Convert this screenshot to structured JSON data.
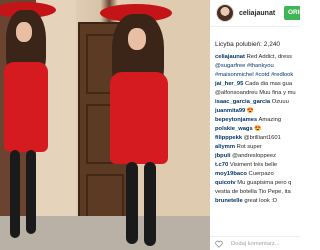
{
  "post": {
    "username": "celiajaunat",
    "follow_label": "ORIGIN",
    "likes_text": "Licyba polubień: 2,240",
    "caption_user": "celiajaunat",
    "caption_lines": [
      "Red Addict, dress",
      "@sugarfree #thankyou",
      "#maisonmichel #cotd #redlook"
    ],
    "comments": [
      {
        "user": "jai_her_95",
        "text": "Cada dia mas gua"
      },
      {
        "user": "",
        "text": "@alfonsoandreu Muu fina y mu"
      },
      {
        "user": "isaac_garcia_garcia",
        "text": "Ozuuu"
      },
      {
        "user": "juanmita99",
        "text": "😍"
      },
      {
        "user": "bepeytonjames",
        "text": "Amazing"
      },
      {
        "user": "polskie_wags",
        "text": "😍"
      },
      {
        "user": "filipppekk",
        "text": "@brilliant1601"
      },
      {
        "user": "aliymm",
        "text": "Rot super"
      },
      {
        "user": "jbpuli",
        "text": "@andresloppeez"
      },
      {
        "user": "t.c70",
        "text": "Visiment très belle"
      },
      {
        "user": "moy19baco",
        "text": "Cuerpazo"
      },
      {
        "user": "quicotv",
        "text": "Mu guapisima pero q"
      },
      {
        "user": "",
        "text": "vestia de botella Tio Pepe, ita"
      },
      {
        "user": "brunetelle",
        "text": "great look :D"
      }
    ],
    "add_comment_placeholder": "Dodaj komentarz..."
  },
  "colors": {
    "accent_green": "#3fb556",
    "link_blue": "#003569",
    "dress_red": "#d51a20"
  }
}
